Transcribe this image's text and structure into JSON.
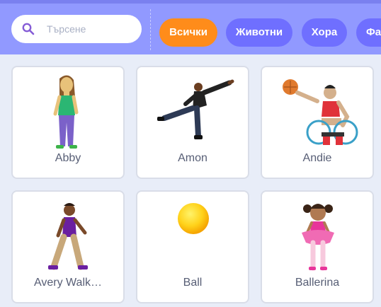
{
  "search": {
    "placeholder": "Търсене",
    "value": ""
  },
  "tags": [
    {
      "label": "Всички",
      "active": true
    },
    {
      "label": "Животни",
      "active": false
    },
    {
      "label": "Хора",
      "active": false
    },
    {
      "label": "Фантазия",
      "active": false
    }
  ],
  "sprites": [
    {
      "name": "Abby",
      "icon": "abby-icon"
    },
    {
      "name": "Amon",
      "icon": "amon-icon"
    },
    {
      "name": "Andie",
      "icon": "andie-icon"
    },
    {
      "name": "Avery Walk…",
      "icon": "avery-walking-icon"
    },
    {
      "name": "Ball",
      "icon": "ball-icon"
    },
    {
      "name": "Ballerina",
      "icon": "ballerina-icon"
    }
  ],
  "colors": {
    "topbar": "#9199ff",
    "tag": "#6f6fff",
    "tag_active": "#ff8c1a",
    "search_icon": "#855cd6",
    "card_text": "#575e75"
  }
}
